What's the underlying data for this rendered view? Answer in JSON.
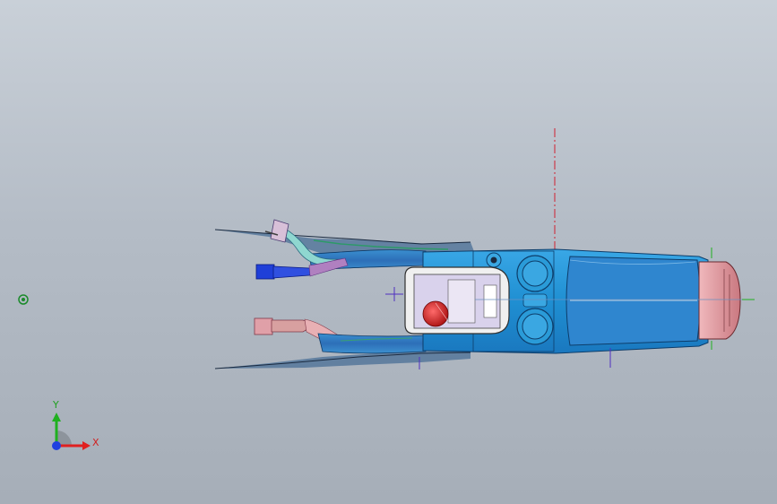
{
  "viewport": {
    "axis_triad": {
      "x_label": "X",
      "y_label": "Y"
    },
    "colors": {
      "background_top": "#c9d0d8",
      "background_bottom": "#a6aeb8",
      "console_body": "#2a9bd8",
      "console_front": "#e8a0a8",
      "dark_duct": "#1f3fd8",
      "pink_duct": "#e0a0a8",
      "centerline": "#d02030",
      "axis_x": "#e02020",
      "axis_y": "#20b020",
      "axis_z": "#2040e0"
    },
    "icons": [
      "origin-marker-icon",
      "axis-triad-icon"
    ]
  }
}
